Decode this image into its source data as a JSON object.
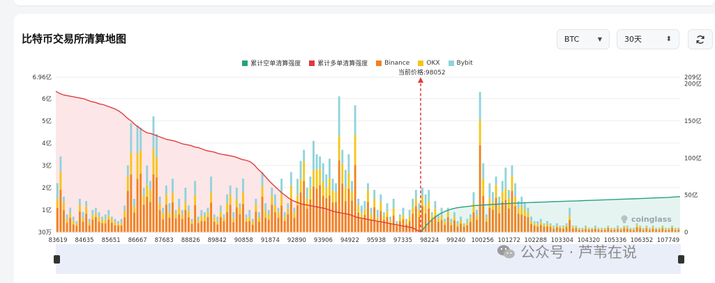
{
  "page": {
    "title": "比特币交易所清算地图",
    "symbol_select": "BTC",
    "period_select": "30天",
    "watermark": "公众号 · 芦苇在说",
    "brand": "coinglass"
  },
  "legend": [
    {
      "label": "累计空单清算强度",
      "color": "#26a17b"
    },
    {
      "label": "累计多单清算强度",
      "color": "#e03a3e"
    },
    {
      "label": "Binance",
      "color": "#f0821e"
    },
    {
      "label": "OKX",
      "color": "#f5c518"
    },
    {
      "label": "Bybit",
      "color": "#8fd3dc"
    }
  ],
  "current_price_label": "当前价格:98052",
  "chart_data": {
    "type": "bar",
    "x_ticks": [
      "83619",
      "84635",
      "85651",
      "86667",
      "87683",
      "88826",
      "89842",
      "90858",
      "91874",
      "92890",
      "93906",
      "94922",
      "95938",
      "97335",
      "98224",
      "99240",
      "100256",
      "101272",
      "102288",
      "103304",
      "104320",
      "105336",
      "106352",
      "107749"
    ],
    "y_left_ticks": [
      "30万",
      "1亿",
      "2亿",
      "3亿",
      "4亿",
      "5亿",
      "6亿",
      "6.96亿"
    ],
    "y_left_values": [
      0.003,
      1,
      2,
      3,
      4,
      5,
      6,
      6.96
    ],
    "y_right_ticks": [
      "0",
      "50亿",
      "100亿",
      "150亿",
      "200亿",
      "209亿"
    ],
    "y_right_values": [
      0,
      50,
      100,
      150,
      200,
      209
    ],
    "ylim_left": [
      0,
      6.96
    ],
    "ylim_right": [
      0,
      209
    ],
    "current_price": 98052,
    "series": [
      {
        "name": "Binance",
        "color": "#f0821e"
      },
      {
        "name": "OKX",
        "color": "#f5c518"
      },
      {
        "name": "Bybit",
        "color": "#8fd3dc"
      },
      {
        "name": "累计多单清算强度",
        "color": "#e03a3e"
      },
      {
        "name": "累计空单清算强度",
        "color": "#26a17b"
      }
    ],
    "bars_total": [
      2.2,
      3.4,
      1.6,
      0.8,
      1.1,
      0.7,
      0.5,
      1.5,
      0.9,
      1.4,
      0.6,
      1.0,
      1.1,
      0.9,
      0.7,
      0.8,
      1.0,
      0.7,
      0.6,
      0.5,
      0.6,
      1.2,
      3.0,
      4.9,
      1.5,
      4.8,
      4.7,
      2.0,
      3.0,
      2.3,
      5.2,
      4.4,
      1.6,
      1.1,
      2.1,
      1.3,
      2.4,
      1.0,
      1.5,
      1.0,
      2.0,
      1.2,
      0.6,
      2.3,
      0.7,
      1.0,
      0.9,
      1.1,
      2.5,
      0.8,
      0.7,
      1.2,
      0.8,
      1.7,
      2.1,
      0.9,
      2.0,
      1.3,
      2.4,
      0.8,
      1.0,
      0.6,
      1.5,
      0.9,
      2.7,
      1.3,
      1.0,
      2.0,
      1.7,
      1.1,
      2.4,
      0.9,
      1.3,
      2.7,
      1.1,
      2.4,
      3.2,
      3.7,
      2.0,
      2.5,
      4.1,
      3.5,
      3.4,
      3.1,
      2.6,
      3.3,
      2.4,
      2.2,
      6.1,
      3.7,
      2.8,
      3.5,
      2.3,
      5.7,
      1.5,
      1.2,
      1.4,
      2.2,
      1.1,
      1.9,
      1.0,
      1.7,
      0.9,
      1.3,
      0.7,
      1.5,
      0.5,
      0.8,
      1.1,
      0.6,
      1.0,
      1.5,
      1.9,
      1.3,
      2.0,
      1.7,
      1.9,
      0.9,
      1.4,
      0.8,
      1.1,
      0.6,
      1.1,
      0.6,
      0.9,
      0.5,
      0.7,
      0.4,
      0.6,
      0.8,
      1.8,
      1.0,
      6.3,
      3.1,
      0.8,
      2.2,
      1.8,
      2.5,
      1.6,
      2.3,
      2.9,
      1.9,
      3.0,
      2.2,
      1.4,
      1.6,
      1.3,
      1.1,
      0.7,
      0.5,
      0.5,
      0.6,
      0.4,
      0.5,
      0.4,
      0.3,
      0.4,
      0.3,
      0.3,
      0.4,
      1.1,
      0.3,
      0.3,
      0.2,
      0.2,
      0.3,
      0.2,
      0.2,
      0.3,
      0.2,
      0.2,
      0.2,
      0.3,
      0.2,
      0.2,
      0.3,
      0.2,
      0.3,
      0.3,
      0.2,
      0.2,
      0.4,
      0.3,
      0.2,
      0.3,
      0.2,
      0.3,
      0.2,
      0.2,
      0.3,
      0.2,
      0.2,
      0.3,
      0.2,
      0.2
    ],
    "long_cumulative": [
      190,
      187,
      185,
      184,
      183,
      182,
      181,
      180,
      178,
      176,
      175,
      173,
      172,
      170,
      168,
      166,
      163,
      159,
      154,
      150,
      145,
      141,
      137,
      134,
      133,
      131,
      129,
      127,
      125,
      124,
      123,
      121,
      119,
      118,
      117,
      115,
      114,
      112,
      110,
      109,
      108,
      106,
      105,
      104,
      103,
      102,
      100,
      98,
      97,
      95,
      91,
      85,
      80,
      74,
      68,
      63,
      58,
      53,
      49,
      45,
      42,
      40,
      38,
      37,
      36,
      35,
      34,
      33,
      32,
      30,
      28,
      27,
      26,
      25,
      24,
      22,
      20,
      19,
      18,
      17,
      16,
      15,
      14,
      13,
      12,
      11,
      10,
      9,
      8,
      7,
      6,
      3,
      0
    ],
    "short_cumulative": [
      0,
      10,
      18,
      24,
      28,
      31,
      33,
      34,
      35,
      36,
      36.5,
      37,
      37.5,
      38,
      38.5,
      39,
      39.3,
      39.6,
      40,
      40.3,
      40.6,
      40.9,
      41.2,
      41.5,
      41.8,
      42,
      42.3,
      42.6,
      42.9,
      43.2,
      43.5,
      43.8,
      44.1,
      44.4,
      44.7,
      45,
      45.3,
      45.6,
      46,
      46.3,
      46.6,
      47,
      47.5,
      48
    ]
  }
}
